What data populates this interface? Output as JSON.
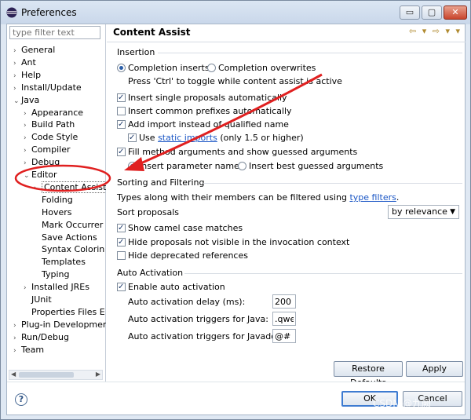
{
  "window": {
    "title": "Preferences",
    "minimize_label": "▭",
    "maximize_label": "▢",
    "close_label": "✕"
  },
  "filter": {
    "placeholder": "type filter text"
  },
  "tree": [
    {
      "label": "General",
      "twisty": "›"
    },
    {
      "label": "Ant",
      "twisty": "›"
    },
    {
      "label": "Help",
      "twisty": "›"
    },
    {
      "label": "Install/Update",
      "twisty": "›"
    },
    {
      "label": "Java",
      "twisty": "⌄"
    },
    {
      "label": "Appearance",
      "twisty": "›"
    },
    {
      "label": "Build Path",
      "twisty": "›"
    },
    {
      "label": "Code Style",
      "twisty": "›"
    },
    {
      "label": "Compiler",
      "twisty": "›"
    },
    {
      "label": "Debug",
      "twisty": "›"
    },
    {
      "label": "Editor",
      "twisty": "⌄"
    },
    {
      "label": "Content Assist",
      "twisty": "›"
    },
    {
      "label": "Folding",
      "twisty": ""
    },
    {
      "label": "Hovers",
      "twisty": ""
    },
    {
      "label": "Mark Occurrer",
      "twisty": ""
    },
    {
      "label": "Save Actions",
      "twisty": ""
    },
    {
      "label": "Syntax Colorin",
      "twisty": ""
    },
    {
      "label": "Templates",
      "twisty": ""
    },
    {
      "label": "Typing",
      "twisty": ""
    },
    {
      "label": "Installed JREs",
      "twisty": "›"
    },
    {
      "label": "JUnit",
      "twisty": ""
    },
    {
      "label": "Properties Files E",
      "twisty": ""
    },
    {
      "label": "Plug-in Developmer",
      "twisty": "›"
    },
    {
      "label": "Run/Debug",
      "twisty": "›"
    },
    {
      "label": "Team",
      "twisty": "›"
    }
  ],
  "page": {
    "title": "Content Assist",
    "nav_arrows": "⇦ ▾ ⇨ ▾ ▾"
  },
  "insertion": {
    "label": "Insertion",
    "completion_inserts": "Completion inserts",
    "completion_overwrites": "Completion overwrites",
    "toggle_hint": "Press 'Ctrl' to toggle while content assist is active",
    "single_proposals": "Insert single proposals automatically",
    "common_prefixes": "Insert common prefixes automatically",
    "add_import": "Add import instead of qualified name",
    "use_label": "Use",
    "static_imports": "static imports",
    "static_suffix": "(only 1.5 or higher)",
    "fill_method_args": "Fill method arguments and show guessed arguments",
    "insert_param_names": "Insert parameter names",
    "insert_best_guessed": "Insert best guessed arguments"
  },
  "sorting": {
    "label": "Sorting and Filtering",
    "types_text": "Types along with their members can be filtered using",
    "type_filters": "type filters",
    "period": ".",
    "sort_proposals": "Sort proposals",
    "sort_value": "by relevance",
    "show_camel": "Show camel case matches",
    "hide_not_visible": "Hide proposals not visible in the invocation context",
    "hide_deprecated": "Hide deprecated references"
  },
  "auto": {
    "label": "Auto Activation",
    "enable": "Enable auto activation",
    "delay_label": "Auto activation delay (ms):",
    "delay_value": "200",
    "java_label": "Auto activation triggers for Java:",
    "java_value": ".qwe",
    "javadoc_label": "Auto activation triggers for Javadoc:",
    "javadoc_value": "@#"
  },
  "buttons": {
    "restore": "Restore Defaults",
    "apply": "Apply",
    "ok": "OK",
    "cancel": "Cancel"
  },
  "watermark": "CSDN @九阙",
  "colors": {
    "annotation": "#e02020",
    "link": "#1a56c5"
  }
}
